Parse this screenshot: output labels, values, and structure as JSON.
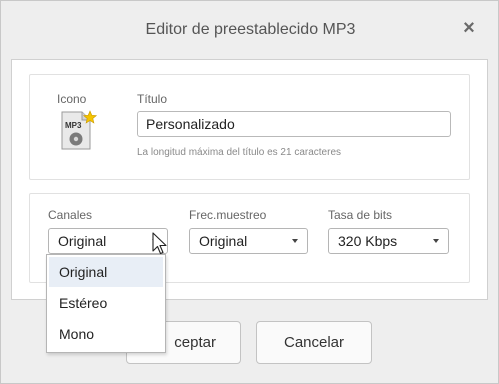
{
  "dialog": {
    "title": "Editor de preestablecido MP3",
    "close_glyph": "×"
  },
  "icon_section": {
    "icon_label": "Icono",
    "icon_name": "mp3-file-icon",
    "icon_text": "MP3",
    "title_label": "Título",
    "title_value": "Personalizado",
    "title_hint": "La longitud máxima del título es 21 caracteres"
  },
  "settings": {
    "channels_label": "Canales",
    "channels_value": "Original",
    "sample_rate_label": "Frec.muestreo",
    "sample_rate_value": "Original",
    "bitrate_label": "Tasa de bits",
    "bitrate_value": "320 Kbps"
  },
  "channels_dropdown": {
    "options": [
      "Original",
      "Estéreo",
      "Mono"
    ],
    "selected_index": 0
  },
  "buttons": {
    "accept_visible": "ceptar",
    "cancel": "Cancelar"
  },
  "colors": {
    "dialog_bg": "#eeeeee",
    "panel_bg": "#ffffff",
    "selected_option_bg": "#e8eef6",
    "star": "#f5c400"
  }
}
